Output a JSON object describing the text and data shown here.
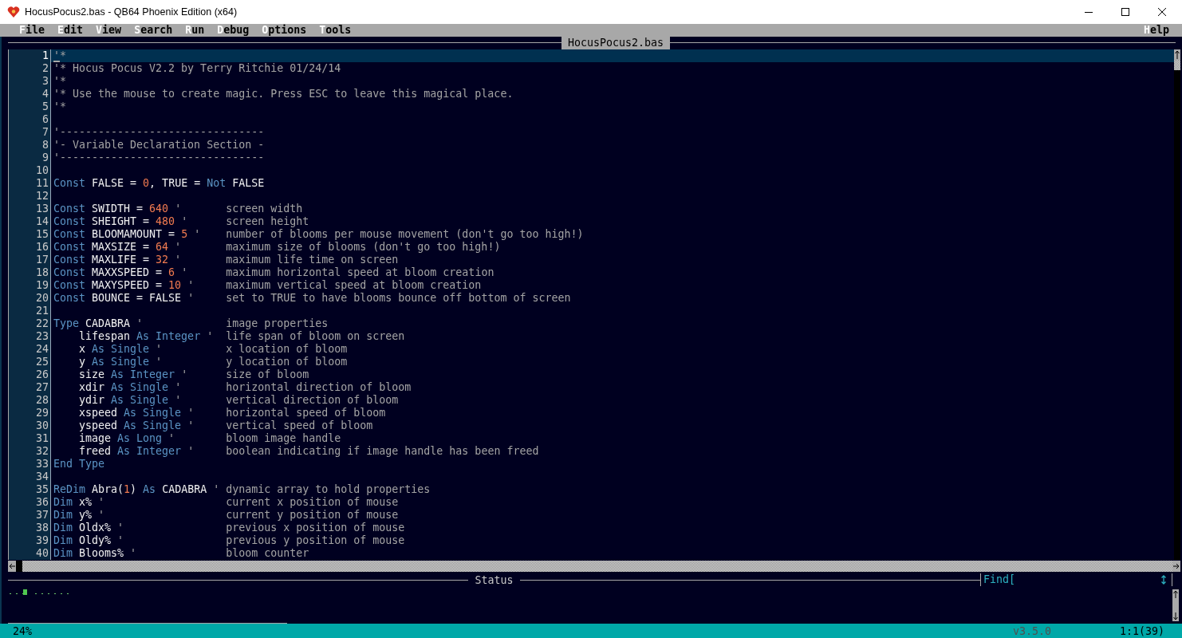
{
  "window": {
    "title": "HocusPocus2.bas - QB64 Phoenix Edition (x64)"
  },
  "menu": {
    "left": [
      {
        "label": "File"
      },
      {
        "label": "Edit"
      },
      {
        "label": "View"
      },
      {
        "label": "Search"
      },
      {
        "label": "Run"
      },
      {
        "label": "Debug"
      },
      {
        "label": "Options"
      },
      {
        "label": "Tools"
      }
    ],
    "right": [
      {
        "label": "Help"
      }
    ]
  },
  "editor": {
    "tab": "HocusPocus2.bas",
    "lines": [
      {
        "number": "1",
        "current": true,
        "tokens": [
          {
            "kind": "comment",
            "text": "'*"
          }
        ]
      },
      {
        "number": "2",
        "current": false,
        "tokens": [
          {
            "kind": "comment",
            "text": "'* Hocus Pocus V2.2 by Terry Ritchie 01/24/14"
          }
        ]
      },
      {
        "number": "3",
        "current": false,
        "tokens": [
          {
            "kind": "comment",
            "text": "'*"
          }
        ]
      },
      {
        "number": "4",
        "current": false,
        "tokens": [
          {
            "kind": "comment",
            "text": "'* Use the mouse to create magic. Press ESC to leave this magical place."
          }
        ]
      },
      {
        "number": "5",
        "current": false,
        "tokens": [
          {
            "kind": "comment",
            "text": "'*"
          }
        ]
      },
      {
        "number": "6",
        "current": false
      },
      {
        "number": "7",
        "current": false,
        "tokens": [
          {
            "kind": "comment",
            "text": "'--------------------------------"
          }
        ]
      },
      {
        "number": "8",
        "current": false,
        "tokens": [
          {
            "kind": "comment",
            "text": "'- Variable Declaration Section -"
          }
        ]
      },
      {
        "number": "9",
        "current": false,
        "tokens": [
          {
            "kind": "comment",
            "text": "'--------------------------------"
          }
        ]
      },
      {
        "number": "10",
        "current": false
      },
      {
        "number": "11",
        "current": false,
        "tokens": [
          {
            "kind": "keyword",
            "text": "Const"
          },
          {
            "kind": "name",
            "text": " FALSE = "
          },
          {
            "kind": "number",
            "text": "0"
          },
          {
            "kind": "name",
            "text": ", TRUE = "
          },
          {
            "kind": "keyword",
            "text": "Not"
          },
          {
            "kind": "name",
            "text": " FALSE"
          }
        ]
      },
      {
        "number": "12",
        "current": false
      },
      {
        "number": "13",
        "current": false,
        "tokens": [
          {
            "kind": "keyword",
            "text": "Const"
          },
          {
            "kind": "name",
            "text": " SWIDTH = "
          },
          {
            "kind": "number",
            "text": "640"
          },
          {
            "kind": "comment",
            "text": " '       screen width"
          }
        ]
      },
      {
        "number": "14",
        "current": false,
        "tokens": [
          {
            "kind": "keyword",
            "text": "Const"
          },
          {
            "kind": "name",
            "text": " SHEIGHT = "
          },
          {
            "kind": "number",
            "text": "480"
          },
          {
            "kind": "comment",
            "text": " '      screen height"
          }
        ]
      },
      {
        "number": "15",
        "current": false,
        "tokens": [
          {
            "kind": "keyword",
            "text": "Const"
          },
          {
            "kind": "name",
            "text": " BLOOMAMOUNT = "
          },
          {
            "kind": "number",
            "text": "5"
          },
          {
            "kind": "comment",
            "text": " '    number of blooms per mouse movement (don't go too high!)"
          }
        ]
      },
      {
        "number": "16",
        "current": false,
        "tokens": [
          {
            "kind": "keyword",
            "text": "Const"
          },
          {
            "kind": "name",
            "text": " MAXSIZE = "
          },
          {
            "kind": "number",
            "text": "64"
          },
          {
            "kind": "comment",
            "text": " '       maximum size of blooms (don't go too high!)"
          }
        ]
      },
      {
        "number": "17",
        "current": false,
        "tokens": [
          {
            "kind": "keyword",
            "text": "Const"
          },
          {
            "kind": "name",
            "text": " MAXLIFE = "
          },
          {
            "kind": "number",
            "text": "32"
          },
          {
            "kind": "comment",
            "text": " '       maximum life time on screen"
          }
        ]
      },
      {
        "number": "18",
        "current": false,
        "tokens": [
          {
            "kind": "keyword",
            "text": "Const"
          },
          {
            "kind": "name",
            "text": " MAXXSPEED = "
          },
          {
            "kind": "number",
            "text": "6"
          },
          {
            "kind": "comment",
            "text": " '      maximum horizontal speed at bloom creation"
          }
        ]
      },
      {
        "number": "19",
        "current": false,
        "tokens": [
          {
            "kind": "keyword",
            "text": "Const"
          },
          {
            "kind": "name",
            "text": " MAXYSPEED = "
          },
          {
            "kind": "number",
            "text": "10"
          },
          {
            "kind": "comment",
            "text": " '     maximum vertical speed at bloom creation"
          }
        ]
      },
      {
        "number": "20",
        "current": false,
        "tokens": [
          {
            "kind": "keyword",
            "text": "Const"
          },
          {
            "kind": "name",
            "text": " BOUNCE = FALSE"
          },
          {
            "kind": "comment",
            "text": " '     set to TRUE to have blooms bounce off bottom of screen"
          }
        ]
      },
      {
        "number": "21",
        "current": false
      },
      {
        "number": "22",
        "current": false,
        "tokens": [
          {
            "kind": "keyword",
            "text": "Type"
          },
          {
            "kind": "name",
            "text": " CADABRA"
          },
          {
            "kind": "comment",
            "text": " '             image properties"
          }
        ]
      },
      {
        "number": "23",
        "current": false,
        "tokens": [
          {
            "kind": "name",
            "text": "    lifespan "
          },
          {
            "kind": "keyword",
            "text": "As Integer"
          },
          {
            "kind": "comment",
            "text": " '  life span of bloom on screen"
          }
        ]
      },
      {
        "number": "24",
        "current": false,
        "tokens": [
          {
            "kind": "name",
            "text": "    x "
          },
          {
            "kind": "keyword",
            "text": "As Single"
          },
          {
            "kind": "comment",
            "text": " '          x location of bloom"
          }
        ]
      },
      {
        "number": "25",
        "current": false,
        "tokens": [
          {
            "kind": "name",
            "text": "    y "
          },
          {
            "kind": "keyword",
            "text": "As Single"
          },
          {
            "kind": "comment",
            "text": " '          y location of bloom"
          }
        ]
      },
      {
        "number": "26",
        "current": false,
        "tokens": [
          {
            "kind": "name",
            "text": "    size "
          },
          {
            "kind": "keyword",
            "text": "As Integer"
          },
          {
            "kind": "comment",
            "text": " '      size of bloom"
          }
        ]
      },
      {
        "number": "27",
        "current": false,
        "tokens": [
          {
            "kind": "name",
            "text": "    xdir "
          },
          {
            "kind": "keyword",
            "text": "As Single"
          },
          {
            "kind": "comment",
            "text": " '       horizontal direction of bloom"
          }
        ]
      },
      {
        "number": "28",
        "current": false,
        "tokens": [
          {
            "kind": "name",
            "text": "    ydir "
          },
          {
            "kind": "keyword",
            "text": "As Single"
          },
          {
            "kind": "comment",
            "text": " '       vertical direction of bloom"
          }
        ]
      },
      {
        "number": "29",
        "current": false,
        "tokens": [
          {
            "kind": "name",
            "text": "    xspeed "
          },
          {
            "kind": "keyword",
            "text": "As Single"
          },
          {
            "kind": "comment",
            "text": " '     horizontal speed of bloom"
          }
        ]
      },
      {
        "number": "30",
        "current": false,
        "tokens": [
          {
            "kind": "name",
            "text": "    yspeed "
          },
          {
            "kind": "keyword",
            "text": "As Single"
          },
          {
            "kind": "comment",
            "text": " '     vertical speed of bloom"
          }
        ]
      },
      {
        "number": "31",
        "current": false,
        "tokens": [
          {
            "kind": "name",
            "text": "    image "
          },
          {
            "kind": "keyword",
            "text": "As Long"
          },
          {
            "kind": "comment",
            "text": " '        bloom image handle"
          }
        ]
      },
      {
        "number": "32",
        "current": false,
        "tokens": [
          {
            "kind": "name",
            "text": "    freed "
          },
          {
            "kind": "keyword",
            "text": "As Integer"
          },
          {
            "kind": "comment",
            "text": " '     boolean indicating if image handle has been freed"
          }
        ]
      },
      {
        "number": "33",
        "current": false,
        "tokens": [
          {
            "kind": "keyword",
            "text": "End Type"
          }
        ]
      },
      {
        "number": "34",
        "current": false
      },
      {
        "number": "35",
        "current": false,
        "tokens": [
          {
            "kind": "keyword",
            "text": "ReDim"
          },
          {
            "kind": "name",
            "text": " Abra("
          },
          {
            "kind": "number",
            "text": "1"
          },
          {
            "kind": "name",
            "text": ") "
          },
          {
            "kind": "keyword",
            "text": "As"
          },
          {
            "kind": "name",
            "text": " CADABRA"
          },
          {
            "kind": "comment",
            "text": " ' dynamic array to hold properties"
          }
        ]
      },
      {
        "number": "36",
        "current": false,
        "tokens": [
          {
            "kind": "keyword",
            "text": "Dim"
          },
          {
            "kind": "name",
            "text": " x%"
          },
          {
            "kind": "comment",
            "text": " '                   current x position of mouse"
          }
        ]
      },
      {
        "number": "37",
        "current": false,
        "tokens": [
          {
            "kind": "keyword",
            "text": "Dim"
          },
          {
            "kind": "name",
            "text": " y%"
          },
          {
            "kind": "comment",
            "text": " '                   current y position of mouse"
          }
        ]
      },
      {
        "number": "38",
        "current": false,
        "tokens": [
          {
            "kind": "keyword",
            "text": "Dim"
          },
          {
            "kind": "name",
            "text": " Oldx%"
          },
          {
            "kind": "comment",
            "text": " '                previous x position of mouse"
          }
        ]
      },
      {
        "number": "39",
        "current": false,
        "tokens": [
          {
            "kind": "keyword",
            "text": "Dim"
          },
          {
            "kind": "name",
            "text": " Oldy%"
          },
          {
            "kind": "comment",
            "text": " '                previous y position of mouse"
          }
        ]
      },
      {
        "number": "40",
        "current": false,
        "tokens": [
          {
            "kind": "keyword",
            "text": "Dim"
          },
          {
            "kind": "name",
            "text": " Blooms%"
          },
          {
            "kind": "comment",
            "text": " '              bloom counter"
          }
        ]
      }
    ]
  },
  "status": {
    "title": "Status",
    "find_label": "Find["
  },
  "status_bar": {
    "zoom": "24%",
    "version": "v3.5.0",
    "position": "1:1(39)"
  }
}
